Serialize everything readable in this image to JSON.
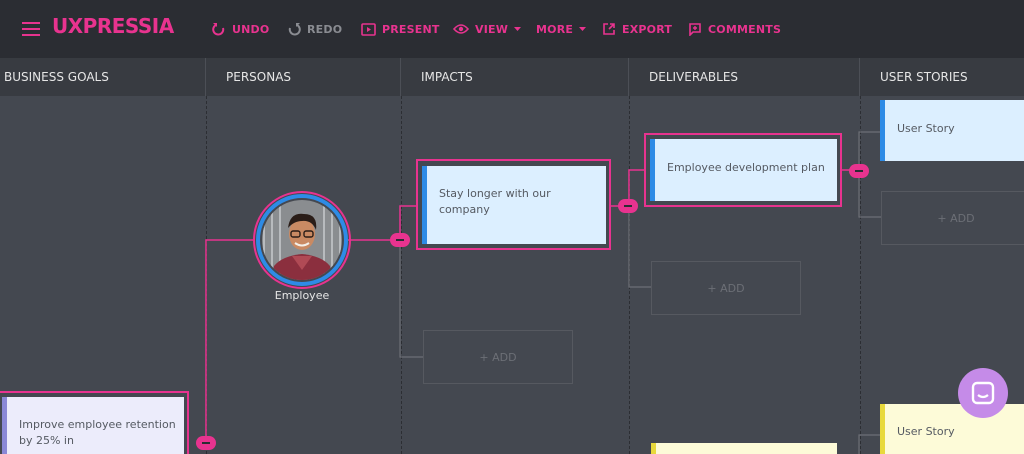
{
  "app": {
    "logo": "UXPRESSIA"
  },
  "toolbar": {
    "undo": "UNDO",
    "redo": "REDO",
    "present": "PRESENT",
    "view": "VIEW",
    "more": "MORE",
    "export": "EXPORT",
    "comments": "COMMENTS"
  },
  "columns": [
    "BUSINESS GOALS",
    "PERSONAS",
    "IMPACTS",
    "DELIVERABLES",
    "USER STORIES"
  ],
  "cards": {
    "business_goal": "Improve employee retention by 25% in",
    "impact": "Stay longer with our company",
    "deliverable": "Employee development plan",
    "user_story_1": "User Story",
    "user_story_2": "User Story"
  },
  "persona": {
    "name": "Employee"
  },
  "add_label": "+ ADD",
  "colors": {
    "accent": "#e8338f",
    "toolbar_bg": "#2b2d33",
    "header_bg": "#383b41",
    "canvas_bg": "#444850",
    "card_blue": "#dcefff",
    "card_lavender": "#ececfb",
    "card_yellow": "#fdfbd8",
    "chat_button": "#c58be8"
  }
}
